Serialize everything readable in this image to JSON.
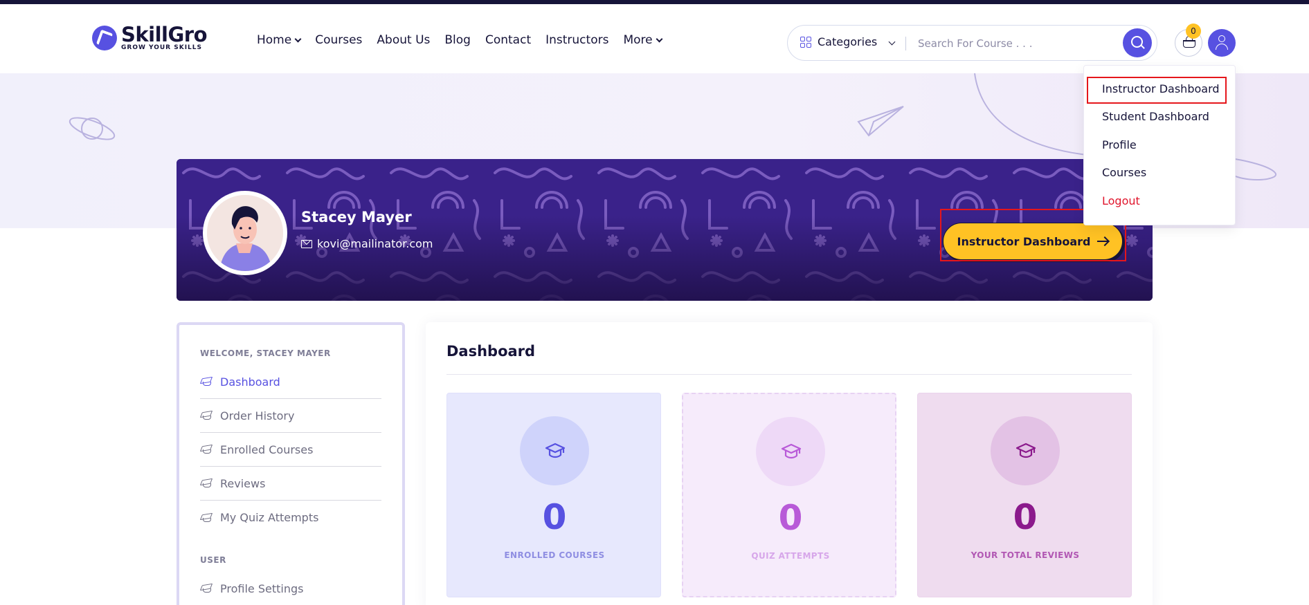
{
  "brand": {
    "name": "SkillGro",
    "tagline": "GROW YOUR SKILLS"
  },
  "nav": {
    "items": [
      {
        "label": "Home",
        "has_dropdown": true
      },
      {
        "label": "Courses",
        "has_dropdown": false
      },
      {
        "label": "About Us",
        "has_dropdown": false
      },
      {
        "label": "Blog",
        "has_dropdown": false
      },
      {
        "label": "Contact",
        "has_dropdown": false
      },
      {
        "label": "Instructors",
        "has_dropdown": false
      },
      {
        "label": "More",
        "has_dropdown": true
      }
    ]
  },
  "search": {
    "category_label": "Categories",
    "placeholder": "Search For Course . . ."
  },
  "cart": {
    "count": "0"
  },
  "user_menu": {
    "items": [
      "Instructor Dashboard",
      "Student Dashboard",
      "Profile",
      "Courses",
      "Logout"
    ]
  },
  "profile": {
    "name": "Stacey Mayer",
    "email": "kovi@mailinator.com",
    "cta_label": "Instructor Dashboard"
  },
  "sidebar": {
    "welcome_heading": "WELCOME, STACEY MAYER",
    "items": [
      "Dashboard",
      "Order History",
      "Enrolled Courses",
      "Reviews",
      "My Quiz Attempts"
    ],
    "active": "Dashboard",
    "user_heading": "USER",
    "user_items": [
      "Profile Settings"
    ]
  },
  "dashboard": {
    "title": "Dashboard",
    "stats": [
      {
        "value": "0",
        "label": "ENROLLED COURSES"
      },
      {
        "value": "0",
        "label": "QUIZ ATTEMPTS"
      },
      {
        "value": "0",
        "label": "YOUR TOTAL REVIEWS"
      }
    ]
  },
  "colors": {
    "primary": "#5751e1",
    "accent": "#ffc224",
    "dark": "#161439",
    "logout": "#e0152c",
    "highlight": "#e5161b"
  }
}
